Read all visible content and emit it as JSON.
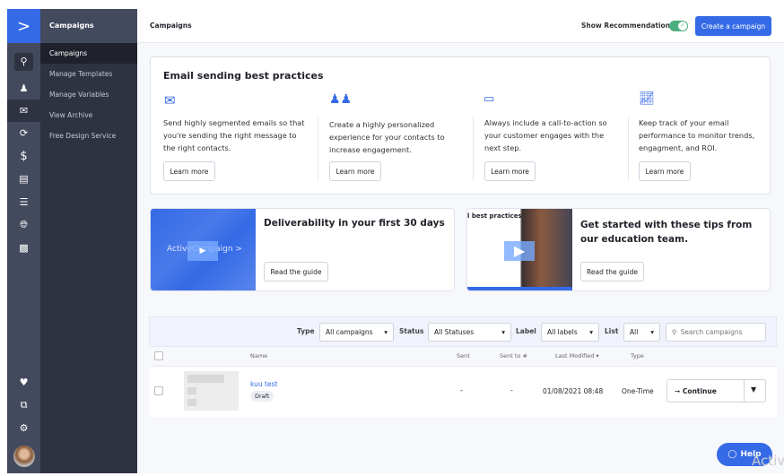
{
  "rail": {
    "logo": ">",
    "icons": [
      "search-icon",
      "contacts-icon",
      "campaigns-icon",
      "automations-icon",
      "deals-icon",
      "conversations-icon",
      "lists-icon",
      "site-icon",
      "reports-icon"
    ],
    "bottom_icons": [
      "heart-icon",
      "apps-icon",
      "gear-icon",
      "avatar"
    ]
  },
  "nav": {
    "title": "Campaigns",
    "items": [
      {
        "label": "Campaigns",
        "active": true
      },
      {
        "label": "Manage Templates"
      },
      {
        "label": "Manage Variables"
      },
      {
        "label": "View Archive"
      },
      {
        "label": "Free Design Service"
      }
    ]
  },
  "header": {
    "title": "Campaigns",
    "toggle_label": "Show Recommendations",
    "toggle_on": true,
    "create_label": "Create a campaign",
    "accent": "#356ae6"
  },
  "best_practices": {
    "title": "Email sending best practices",
    "items": [
      {
        "icon": "envelope-icon",
        "text": "Send highly segmented emails so that you're sending the right message to the right contacts.",
        "button": "Learn more"
      },
      {
        "icon": "people-icon",
        "text": "Create a highly personalized experience for your contacts to increase engagement.",
        "button": "Learn more"
      },
      {
        "icon": "cta-click-icon",
        "text": "Always include a call-to-action so your customer engages with the next step.",
        "button": "Learn more"
      },
      {
        "icon": "chart-icon",
        "text": "Keep track of your email performance to monitor trends, engagment, and ROI.",
        "button": "Learn more"
      }
    ]
  },
  "guides": [
    {
      "title": "Deliverability in your first 30 days",
      "button": "Read the guide",
      "thumb_text": "ActiveCampaign >"
    },
    {
      "title": "Get started with these tips from our education team.",
      "button": "Read the guide",
      "thumb_text": "l best practices"
    }
  ],
  "filters": {
    "type_label": "Type",
    "type_value": "All campaigns",
    "status_label": "Status",
    "status_value": "All Statuses",
    "label_label": "Label",
    "label_value": "All labels",
    "list_label": "List",
    "list_value": "All",
    "search_placeholder": "Search campaigns"
  },
  "table": {
    "headers": {
      "name": "Name",
      "sent": "Sent",
      "sent_to": "Sent to #",
      "modified": "Last Modified",
      "type": "Type"
    },
    "rows": [
      {
        "name": "kuu test",
        "status": "Draft",
        "sent": "-",
        "sent_to": "-",
        "modified": "01/08/2021 08:48",
        "type": "One-Time",
        "action": "Continue"
      }
    ]
  },
  "help": {
    "label": "Help"
  },
  "watermark": "Activ"
}
